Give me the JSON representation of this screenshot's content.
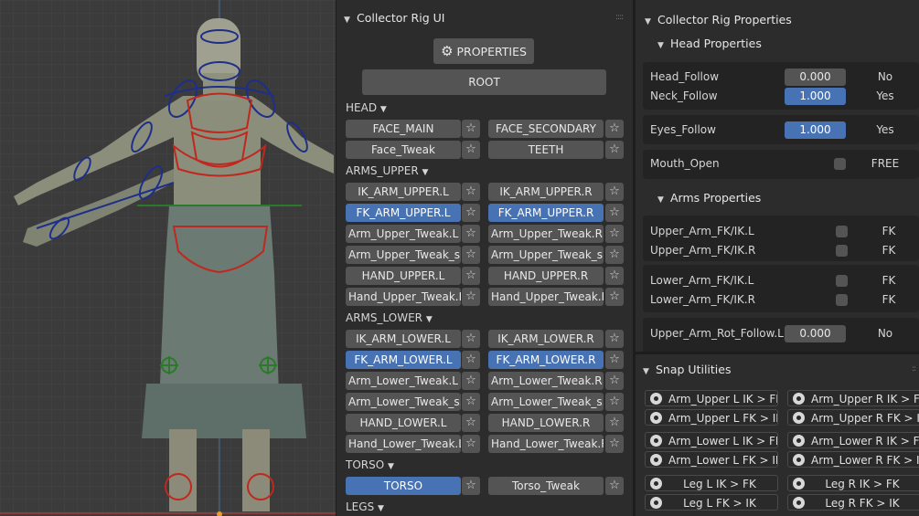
{
  "left_panel": {
    "title": "Collector Rig UI",
    "properties_button": "PROPERTIES",
    "root_button": "ROOT",
    "sections": {
      "head": "HEAD",
      "arms_upper": "ARMS_UPPER",
      "arms_lower": "ARMS_LOWER",
      "torso": "TORSO",
      "legs": "LEGS"
    },
    "head_buttons": [
      "FACE_MAIN",
      "FACE_SECONDARY",
      "Face_Tweak",
      "TEETH"
    ],
    "arms_upper_buttons": [
      "IK_ARM_UPPER.L",
      "IK_ARM_UPPER.R",
      "FK_ARM_UPPER.L",
      "FK_ARM_UPPER.R",
      "Arm_Upper_Tweak.L",
      "Arm_Upper_Tweak.R",
      "Arm_Upper_Tweak_s...",
      "Arm_Upper_Tweak_s...",
      "HAND_UPPER.L",
      "HAND_UPPER.R",
      "Hand_Upper_Tweak.L",
      "Hand_Upper_Tweak.R"
    ],
    "arms_lower_buttons": [
      "IK_ARM_LOWER.L",
      "IK_ARM_LOWER.R",
      "FK_ARM_LOWER.L",
      "FK_ARM_LOWER.R",
      "Arm_Lower_Tweak.L",
      "Arm_Lower_Tweak.R",
      "Arm_Lower_Tweak_s...",
      "Arm_Lower_Tweak_s...",
      "HAND_LOWER.L",
      "HAND_LOWER.R",
      "Hand_Lower_Tweak.L",
      "Hand_Lower_Tweak.R"
    ],
    "torso_buttons": [
      "TORSO",
      "Torso_Tweak"
    ]
  },
  "right_panel": {
    "title": "Collector Rig Properties",
    "head_props_title": "Head Properties",
    "head_props": [
      {
        "label": "Head_Follow",
        "value": "0.000",
        "state": "No"
      },
      {
        "label": "Neck_Follow",
        "value": "1.000",
        "state": "Yes"
      },
      {
        "label": "Eyes_Follow",
        "value": "1.000",
        "state": "Yes"
      },
      {
        "label": "Mouth_Open",
        "state": "FREE"
      }
    ],
    "arms_props_title": "Arms Properties",
    "arms_props": [
      {
        "label": "Upper_Arm_FK/IK.L",
        "state": "FK"
      },
      {
        "label": "Upper_Arm_FK/IK.R",
        "state": "FK"
      },
      {
        "label": "Lower_Arm_FK/IK.L",
        "state": "FK"
      },
      {
        "label": "Lower_Arm_FK/IK.R",
        "state": "FK"
      }
    ],
    "rot_follow": {
      "label": "Upper_Arm_Rot_Follow.L",
      "value": "0.000",
      "state": "No"
    }
  },
  "snap_panel": {
    "title": "Snap Utilities",
    "buttons": [
      "Arm_Upper L IK > FK",
      "Arm_Upper R IK > FK",
      "Arm_Upper L FK > IK",
      "Arm_Upper R FK > IK",
      "Arm_Lower L IK > FK",
      "Arm_Lower R IK > FK",
      "Arm_Lower L FK > IK",
      "Arm_Lower R FK > IK",
      "Leg L IK > FK",
      "Leg R IK > FK",
      "Leg L FK > IK",
      "Leg R FK > IK"
    ]
  },
  "colors": {
    "selected": "#4772b3",
    "bone_upper": "#1e2f8a",
    "bone_torso": "#c0281e"
  },
  "icons": {
    "properties": "gear-icon",
    "favorite": "star-icon",
    "snap": "snap-icon",
    "collapse": "triangle-down-icon"
  }
}
